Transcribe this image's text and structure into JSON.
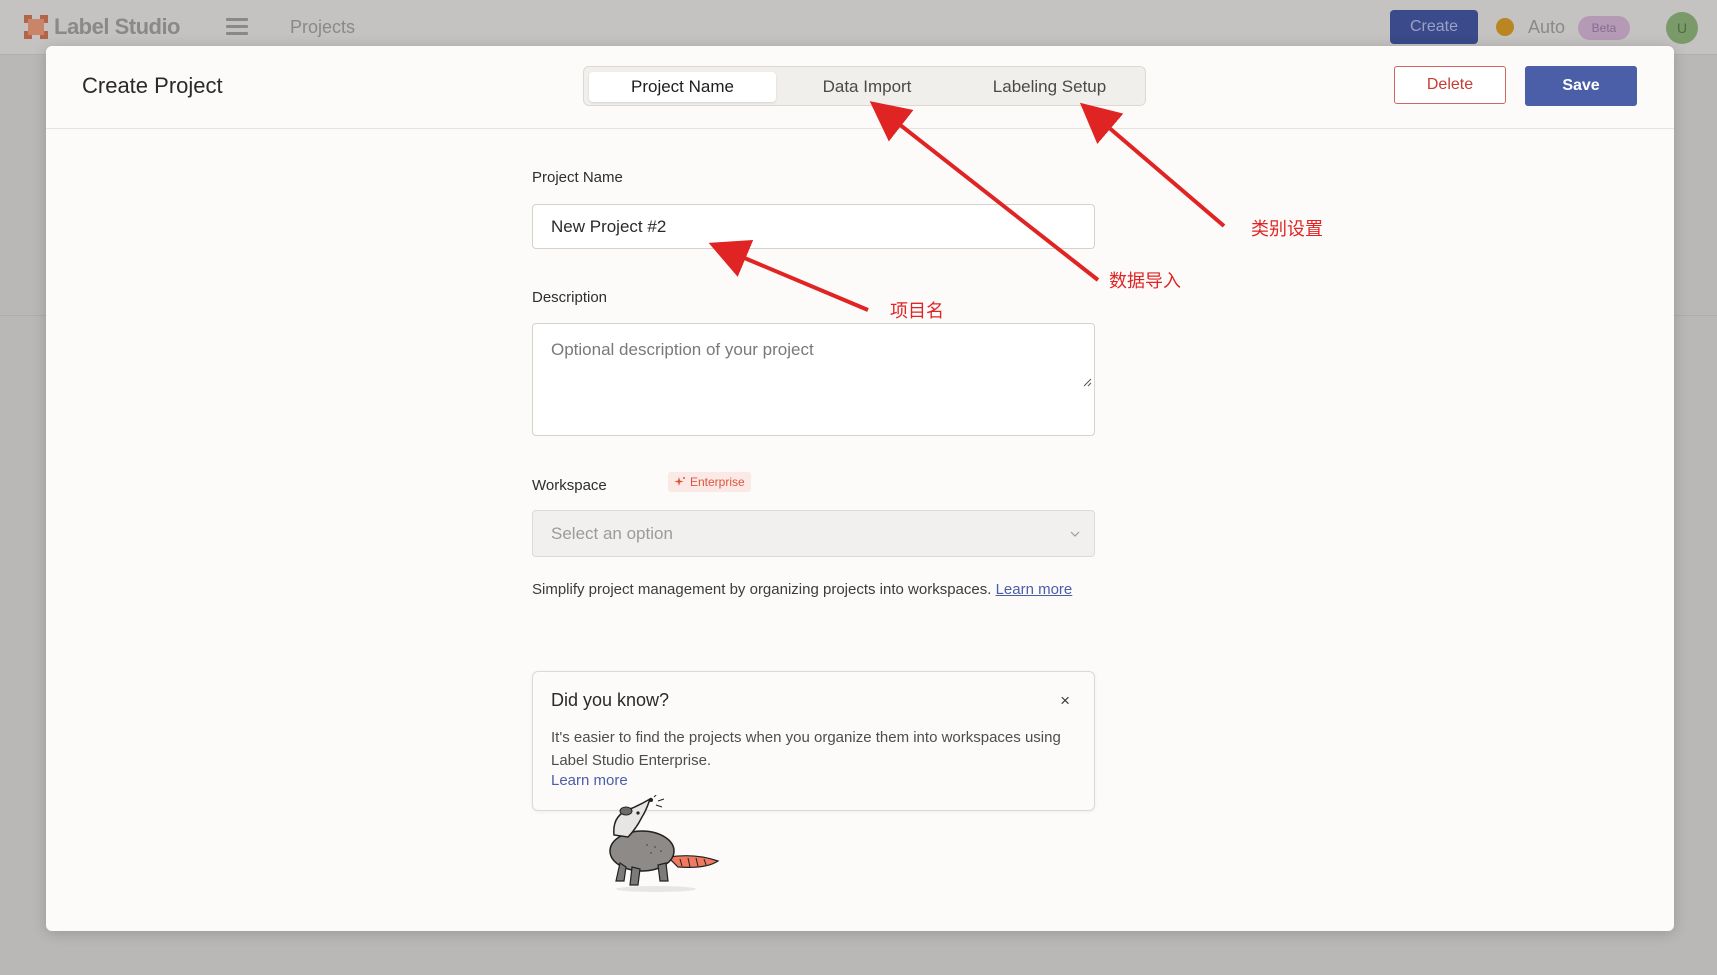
{
  "app": {
    "name": "Label Studio",
    "breadcrumb": "Projects",
    "create_button": "Create",
    "auto_label": "Auto",
    "beta_badge": "Beta",
    "user_initials": "U"
  },
  "modal": {
    "title": "Create Project",
    "tabs": [
      {
        "label": "Project Name",
        "active": true
      },
      {
        "label": "Data Import",
        "active": false
      },
      {
        "label": "Labeling Setup",
        "active": false
      }
    ],
    "delete_button": "Delete",
    "save_button": "Save"
  },
  "form": {
    "project_name": {
      "label": "Project Name",
      "value": "New Project #2"
    },
    "description": {
      "label": "Description",
      "placeholder": "Optional description of your project"
    },
    "workspace": {
      "label": "Workspace",
      "badge": "Enterprise",
      "placeholder": "Select an option",
      "help_text": "Simplify project management by organizing projects into workspaces. ",
      "help_link": "Learn more"
    }
  },
  "tip": {
    "title": "Did you know?",
    "body": "It's easier to find the projects when you organize them into workspaces using Label Studio Enterprise.",
    "link": "Learn more",
    "close": "×"
  },
  "annotations": {
    "labeling_setup": "类别设置",
    "data_import": "数据导入",
    "project_name": "项目名"
  },
  "colors": {
    "accent": "#4b5ea8",
    "danger": "#c73c34",
    "annotation": "#e02424"
  }
}
